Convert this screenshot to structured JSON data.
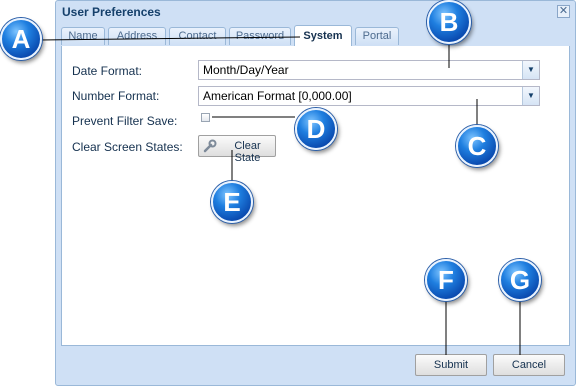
{
  "dialog": {
    "title": "User Preferences",
    "close_icon": "close-icon"
  },
  "tabs": [
    {
      "label": "Name",
      "active": false
    },
    {
      "label": "Address",
      "active": false
    },
    {
      "label": "Contact",
      "active": false
    },
    {
      "label": "Password",
      "active": false
    },
    {
      "label": "System",
      "active": true
    },
    {
      "label": "Portal",
      "active": false
    }
  ],
  "form": {
    "date_format": {
      "label": "Date Format:",
      "value": "Month/Day/Year"
    },
    "number_format": {
      "label": "Number Format:",
      "value": "American Format [0,000.00]"
    },
    "prevent_filter_save": {
      "label": "Prevent Filter Save:",
      "checked": false
    },
    "clear_screen_states": {
      "label": "Clear Screen States:",
      "button_label": "Clear State",
      "button_icon": "wrench-icon"
    }
  },
  "footer": {
    "submit_label": "Submit",
    "cancel_label": "Cancel"
  },
  "callouts": [
    "A",
    "B",
    "C",
    "D",
    "E",
    "F",
    "G"
  ],
  "colors": {
    "accent": "#1f7fe0",
    "dialog_bg": "#cfe0f5",
    "border": "#9ab8d8",
    "title_text": "#15406b"
  }
}
